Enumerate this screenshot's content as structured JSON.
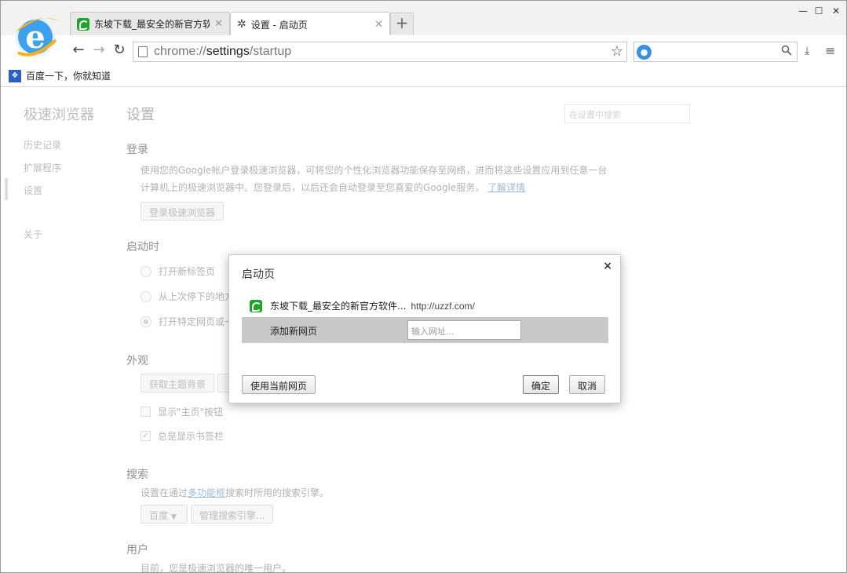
{
  "tabs": [
    {
      "label": "东坡下载_最安全的新官方软",
      "active": false
    },
    {
      "label": "设置 - 启动页",
      "active": true
    }
  ],
  "new_tab": "+",
  "window_controls": [
    "—",
    "☐",
    "✕"
  ],
  "toolbar": {
    "back": "←",
    "forward": "→",
    "reload": "↻",
    "url_scheme": "chrome://",
    "url_path": "settings",
    "url_rest": "/startup",
    "star": "☆",
    "search_placeholder": "",
    "search_icon": "search-icon",
    "download": "⤓",
    "menu": "≡"
  },
  "bookmarks": [
    {
      "label": "百度一下，你就知道",
      "icon": "baidu-paw-icon"
    }
  ],
  "sidebar": {
    "title": "极速浏览器",
    "items": [
      "历史记录",
      "扩展程序",
      "设置",
      "关于"
    ]
  },
  "settings": {
    "title": "设置",
    "search_placeholder": "在设置中搜索",
    "login": {
      "heading": "登录",
      "desc1": "使用您的Google帐户登录极速浏览器，可将您的个性化浏览器功能保存至网络，进而将这些设置应用到任意一台",
      "desc2": "计算机上的极速浏览器中。您登录后，以后还会自动登录至您喜爱的Google服务。",
      "learn_more": "了解详情",
      "button": "登录极速浏览器"
    },
    "startup": {
      "heading": "启动时",
      "options": [
        "打开新标签页",
        "从上次停下的地方",
        "打开特定网页或一"
      ]
    },
    "appearance": {
      "heading": "外观",
      "theme_button": "获取主题背景",
      "show_home": "显示\"主页\"按钮",
      "show_bookmarks": "总是显示书签栏"
    },
    "search": {
      "heading": "搜索",
      "desc_pre": "设置在通过",
      "desc_link": "多功能框",
      "desc_post": "搜索时所用的搜索引擎。",
      "engine": "百度",
      "manage": "管理搜索引擎..."
    },
    "users": {
      "heading": "用户",
      "desc": "目前，您是极速浏览器的唯一用户。"
    }
  },
  "dialog": {
    "title": "启动页",
    "close": "×",
    "page_title": "东坡下载_最安全的新官方软件...",
    "page_url": "http://uzzf.com/",
    "add_label": "添加新网页",
    "add_placeholder": "输入网址...",
    "use_current": "使用当前网页",
    "ok": "确定",
    "cancel": "取消"
  },
  "colors": {
    "dialog_row_bg": "#c8c8c8",
    "link": "#6a92cc",
    "favicon_green": "#1fa32a"
  }
}
